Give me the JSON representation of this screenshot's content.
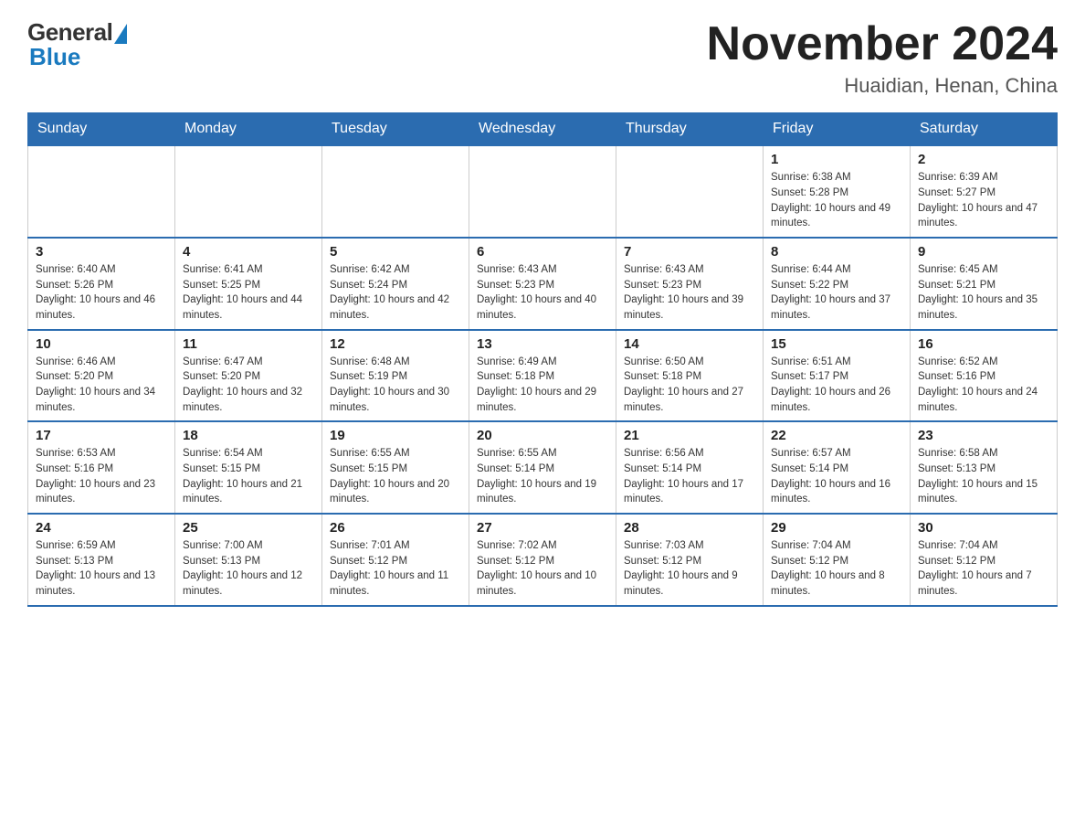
{
  "header": {
    "logo_general": "General",
    "logo_blue": "Blue",
    "month_title": "November 2024",
    "location": "Huaidian, Henan, China"
  },
  "weekdays": [
    "Sunday",
    "Monday",
    "Tuesday",
    "Wednesday",
    "Thursday",
    "Friday",
    "Saturday"
  ],
  "rows": [
    [
      {
        "day": "",
        "sunrise": "",
        "sunset": "",
        "daylight": ""
      },
      {
        "day": "",
        "sunrise": "",
        "sunset": "",
        "daylight": ""
      },
      {
        "day": "",
        "sunrise": "",
        "sunset": "",
        "daylight": ""
      },
      {
        "day": "",
        "sunrise": "",
        "sunset": "",
        "daylight": ""
      },
      {
        "day": "",
        "sunrise": "",
        "sunset": "",
        "daylight": ""
      },
      {
        "day": "1",
        "sunrise": "Sunrise: 6:38 AM",
        "sunset": "Sunset: 5:28 PM",
        "daylight": "Daylight: 10 hours and 49 minutes."
      },
      {
        "day": "2",
        "sunrise": "Sunrise: 6:39 AM",
        "sunset": "Sunset: 5:27 PM",
        "daylight": "Daylight: 10 hours and 47 minutes."
      }
    ],
    [
      {
        "day": "3",
        "sunrise": "Sunrise: 6:40 AM",
        "sunset": "Sunset: 5:26 PM",
        "daylight": "Daylight: 10 hours and 46 minutes."
      },
      {
        "day": "4",
        "sunrise": "Sunrise: 6:41 AM",
        "sunset": "Sunset: 5:25 PM",
        "daylight": "Daylight: 10 hours and 44 minutes."
      },
      {
        "day": "5",
        "sunrise": "Sunrise: 6:42 AM",
        "sunset": "Sunset: 5:24 PM",
        "daylight": "Daylight: 10 hours and 42 minutes."
      },
      {
        "day": "6",
        "sunrise": "Sunrise: 6:43 AM",
        "sunset": "Sunset: 5:23 PM",
        "daylight": "Daylight: 10 hours and 40 minutes."
      },
      {
        "day": "7",
        "sunrise": "Sunrise: 6:43 AM",
        "sunset": "Sunset: 5:23 PM",
        "daylight": "Daylight: 10 hours and 39 minutes."
      },
      {
        "day": "8",
        "sunrise": "Sunrise: 6:44 AM",
        "sunset": "Sunset: 5:22 PM",
        "daylight": "Daylight: 10 hours and 37 minutes."
      },
      {
        "day": "9",
        "sunrise": "Sunrise: 6:45 AM",
        "sunset": "Sunset: 5:21 PM",
        "daylight": "Daylight: 10 hours and 35 minutes."
      }
    ],
    [
      {
        "day": "10",
        "sunrise": "Sunrise: 6:46 AM",
        "sunset": "Sunset: 5:20 PM",
        "daylight": "Daylight: 10 hours and 34 minutes."
      },
      {
        "day": "11",
        "sunrise": "Sunrise: 6:47 AM",
        "sunset": "Sunset: 5:20 PM",
        "daylight": "Daylight: 10 hours and 32 minutes."
      },
      {
        "day": "12",
        "sunrise": "Sunrise: 6:48 AM",
        "sunset": "Sunset: 5:19 PM",
        "daylight": "Daylight: 10 hours and 30 minutes."
      },
      {
        "day": "13",
        "sunrise": "Sunrise: 6:49 AM",
        "sunset": "Sunset: 5:18 PM",
        "daylight": "Daylight: 10 hours and 29 minutes."
      },
      {
        "day": "14",
        "sunrise": "Sunrise: 6:50 AM",
        "sunset": "Sunset: 5:18 PM",
        "daylight": "Daylight: 10 hours and 27 minutes."
      },
      {
        "day": "15",
        "sunrise": "Sunrise: 6:51 AM",
        "sunset": "Sunset: 5:17 PM",
        "daylight": "Daylight: 10 hours and 26 minutes."
      },
      {
        "day": "16",
        "sunrise": "Sunrise: 6:52 AM",
        "sunset": "Sunset: 5:16 PM",
        "daylight": "Daylight: 10 hours and 24 minutes."
      }
    ],
    [
      {
        "day": "17",
        "sunrise": "Sunrise: 6:53 AM",
        "sunset": "Sunset: 5:16 PM",
        "daylight": "Daylight: 10 hours and 23 minutes."
      },
      {
        "day": "18",
        "sunrise": "Sunrise: 6:54 AM",
        "sunset": "Sunset: 5:15 PM",
        "daylight": "Daylight: 10 hours and 21 minutes."
      },
      {
        "day": "19",
        "sunrise": "Sunrise: 6:55 AM",
        "sunset": "Sunset: 5:15 PM",
        "daylight": "Daylight: 10 hours and 20 minutes."
      },
      {
        "day": "20",
        "sunrise": "Sunrise: 6:55 AM",
        "sunset": "Sunset: 5:14 PM",
        "daylight": "Daylight: 10 hours and 19 minutes."
      },
      {
        "day": "21",
        "sunrise": "Sunrise: 6:56 AM",
        "sunset": "Sunset: 5:14 PM",
        "daylight": "Daylight: 10 hours and 17 minutes."
      },
      {
        "day": "22",
        "sunrise": "Sunrise: 6:57 AM",
        "sunset": "Sunset: 5:14 PM",
        "daylight": "Daylight: 10 hours and 16 minutes."
      },
      {
        "day": "23",
        "sunrise": "Sunrise: 6:58 AM",
        "sunset": "Sunset: 5:13 PM",
        "daylight": "Daylight: 10 hours and 15 minutes."
      }
    ],
    [
      {
        "day": "24",
        "sunrise": "Sunrise: 6:59 AM",
        "sunset": "Sunset: 5:13 PM",
        "daylight": "Daylight: 10 hours and 13 minutes."
      },
      {
        "day": "25",
        "sunrise": "Sunrise: 7:00 AM",
        "sunset": "Sunset: 5:13 PM",
        "daylight": "Daylight: 10 hours and 12 minutes."
      },
      {
        "day": "26",
        "sunrise": "Sunrise: 7:01 AM",
        "sunset": "Sunset: 5:12 PM",
        "daylight": "Daylight: 10 hours and 11 minutes."
      },
      {
        "day": "27",
        "sunrise": "Sunrise: 7:02 AM",
        "sunset": "Sunset: 5:12 PM",
        "daylight": "Daylight: 10 hours and 10 minutes."
      },
      {
        "day": "28",
        "sunrise": "Sunrise: 7:03 AM",
        "sunset": "Sunset: 5:12 PM",
        "daylight": "Daylight: 10 hours and 9 minutes."
      },
      {
        "day": "29",
        "sunrise": "Sunrise: 7:04 AM",
        "sunset": "Sunset: 5:12 PM",
        "daylight": "Daylight: 10 hours and 8 minutes."
      },
      {
        "day": "30",
        "sunrise": "Sunrise: 7:04 AM",
        "sunset": "Sunset: 5:12 PM",
        "daylight": "Daylight: 10 hours and 7 minutes."
      }
    ]
  ]
}
